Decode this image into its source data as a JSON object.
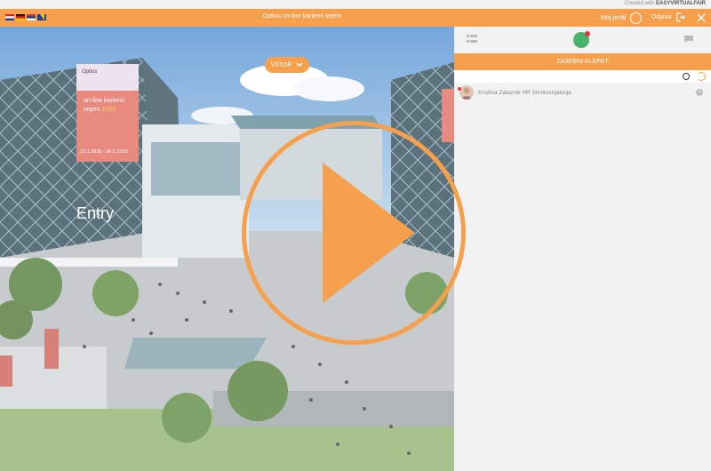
{
  "topbar": {
    "created_prefix": "Created with",
    "created_brand": "EASYVIRTUALFAIR"
  },
  "header": {
    "title": "Optius on-line karierni sejem",
    "profile_label": "Moj profil",
    "logout_label": "Odjava",
    "flags": [
      "croatia-flag",
      "germany-flag",
      "serbia-flag",
      "bosnia-flag"
    ],
    "accent_color": "#f6a04d"
  },
  "scene": {
    "vstop_label": "VSTOP",
    "entry_sign": "Entry",
    "banner": {
      "brand": "Optius",
      "line1": "on-line karierni",
      "line2": "sejem",
      "year": "2020",
      "dates": "22.1.2020 - 26.1.2020"
    }
  },
  "panel": {
    "section_title": "ZASEBNI KLEPET",
    "search_placeholder": "",
    "chats": [
      {
        "name": "Kristina Zalaznik HR Strokovnjakinja"
      }
    ]
  },
  "overlay": {
    "icon": "play-icon",
    "color": "#f6a04d"
  }
}
